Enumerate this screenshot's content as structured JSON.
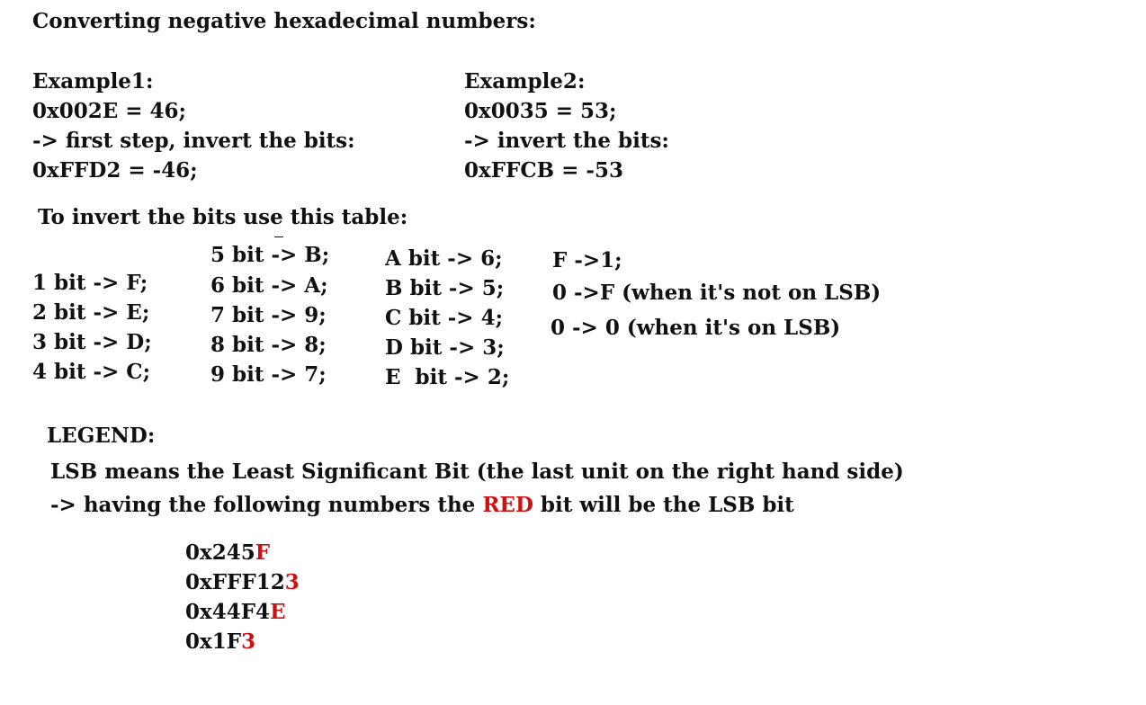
{
  "title": "Converting negative hexadecimal numbers:",
  "example1": {
    "heading": "Example1:",
    "line1": "0x002E = 46;",
    "line2": "-> first step, invert the bits:",
    "line3": "0xFFD2 = -46;"
  },
  "example2": {
    "heading": "Example2:",
    "line1": "0x0035 = 53;",
    "line2": "-> invert the bits:",
    "line3": "0xFFCB = -53"
  },
  "table": {
    "heading": "To invert the bits use this table:",
    "col1": [
      "1 bit -> F;",
      "2 bit -> E;",
      "3 bit -> D;",
      "4 bit -> C;"
    ],
    "col2": [
      "5 bit -> B;",
      "6 bit -> A;",
      "7 bit -> 9;",
      "8 bit -> 8;",
      "9 bit -> 7;"
    ],
    "col3": [
      "A bit -> 6;",
      "B bit -> 5;",
      "C bit -> 4;",
      "D bit -> 3;",
      "E  bit -> 2;"
    ],
    "col4": [
      "F ->1;",
      "0 ->F (when it's not on LSB)",
      "0 -> 0 (when it's on LSB)"
    ]
  },
  "legend": {
    "heading": "LEGEND:",
    "line1": "LSB means the Least Significant Bit (the last unit on the right hand side)",
    "line2_before": "-> having the following numbers the ",
    "line2_red": "RED",
    "line2_after": " bit will be the LSB bit"
  },
  "examples": [
    {
      "prefix": "0x245",
      "lsb": "F"
    },
    {
      "prefix": "0xFFF12",
      "lsb": "3"
    },
    {
      "prefix": "0x44F4",
      "lsb": "E"
    },
    {
      "prefix": "0x1F",
      "lsb": "3"
    }
  ],
  "colors": {
    "text": "#111111",
    "highlight": "#d01010",
    "background": "#ffffff"
  }
}
